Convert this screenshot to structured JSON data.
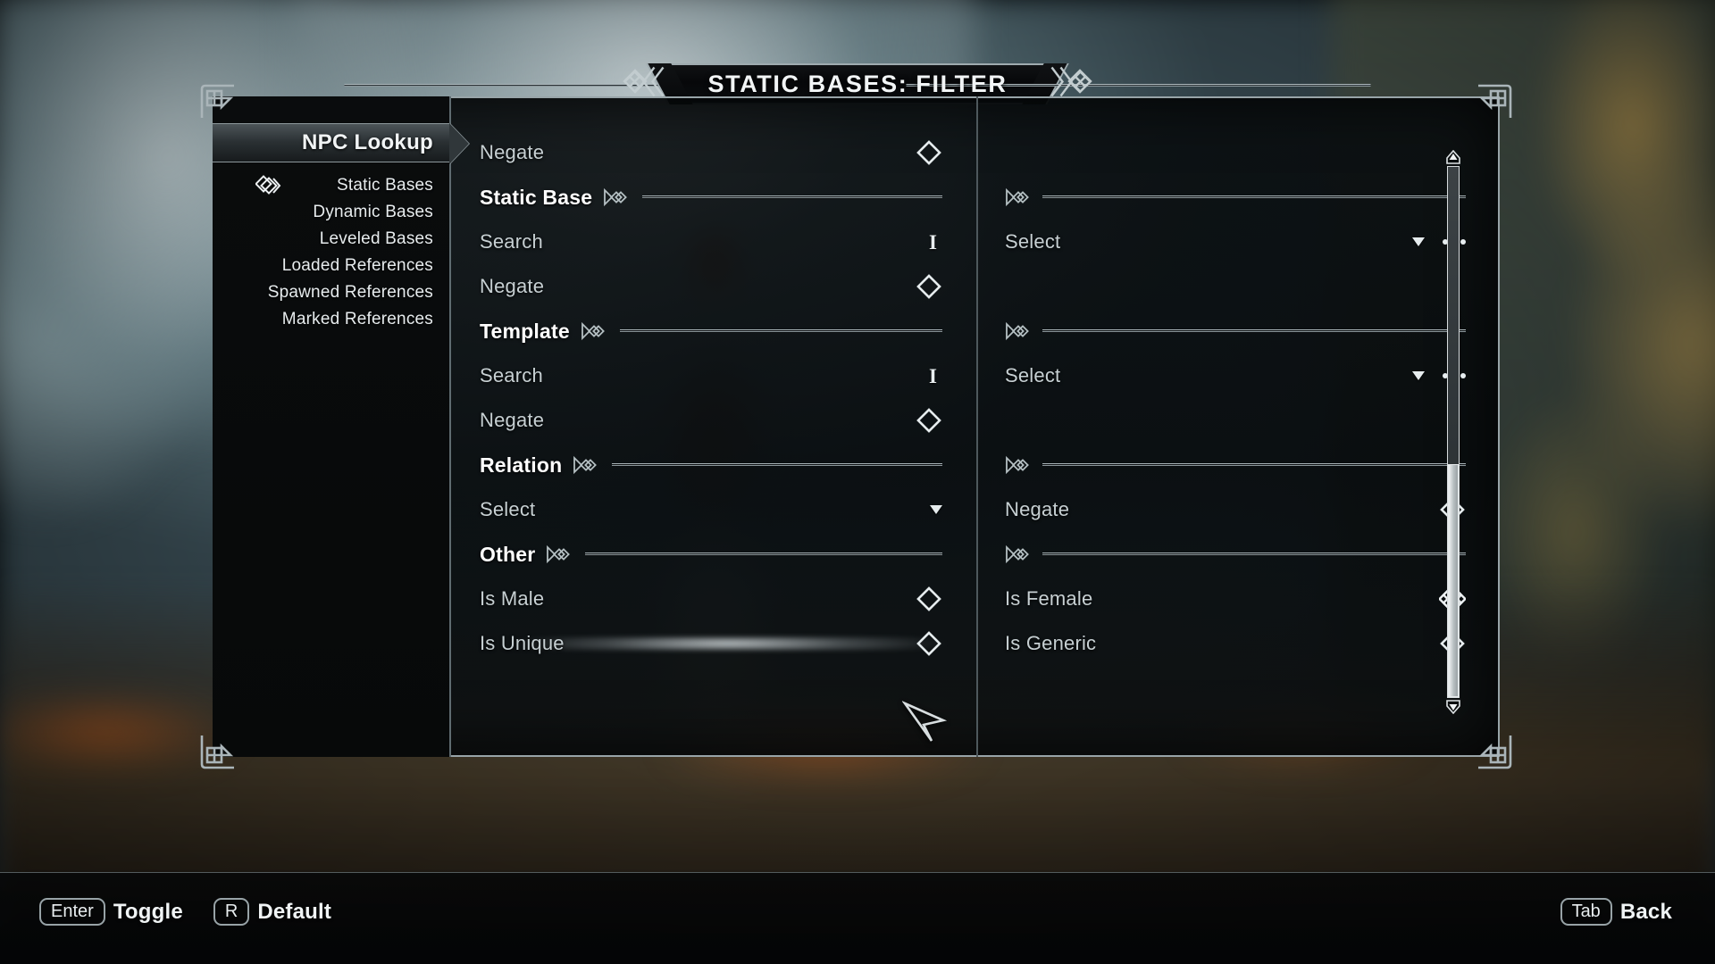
{
  "window": {
    "title": "STATIC BASES: FILTER"
  },
  "sidebar": {
    "header": "NPC Lookup",
    "items": [
      {
        "label": "Static Bases",
        "icon": "knot-marker-icon",
        "selected": true
      },
      {
        "label": "Dynamic Bases",
        "icon": "",
        "selected": false
      },
      {
        "label": "Leveled Bases",
        "icon": "",
        "selected": false
      },
      {
        "label": "Loaded References",
        "icon": "",
        "selected": false
      },
      {
        "label": "Spawned References",
        "icon": "",
        "selected": false
      },
      {
        "label": "Marked References",
        "icon": "",
        "selected": false
      }
    ]
  },
  "left_column": [
    {
      "type": "checkbox",
      "label": "Negate",
      "control": "diamond-unchecked-icon"
    },
    {
      "type": "section",
      "label": "Static Base",
      "control": "knot-divider-icon"
    },
    {
      "type": "text",
      "label": "Search",
      "control": "text-cursor-icon",
      "value": ""
    },
    {
      "type": "checkbox",
      "label": "Negate",
      "control": "diamond-unchecked-icon"
    },
    {
      "type": "section",
      "label": "Template",
      "control": "knot-divider-icon"
    },
    {
      "type": "text",
      "label": "Search",
      "control": "text-cursor-icon",
      "value": ""
    },
    {
      "type": "checkbox",
      "label": "Negate",
      "control": "diamond-unchecked-icon"
    },
    {
      "type": "section",
      "label": "Relation",
      "control": "knot-divider-icon"
    },
    {
      "type": "dropdown",
      "label": "Select",
      "control": "caret-down-icon"
    },
    {
      "type": "section",
      "label": "Other",
      "control": "knot-divider-icon"
    },
    {
      "type": "checkbox",
      "label": "Is Male",
      "control": "diamond-unchecked-icon"
    },
    {
      "type": "checkbox",
      "label": "Is Unique",
      "control": "diamond-unchecked-icon",
      "highlighted": true
    }
  ],
  "right_column": [
    {
      "type": "spacer",
      "label": "",
      "control": ""
    },
    {
      "type": "divider",
      "label": "",
      "control": "knot-divider-icon"
    },
    {
      "type": "dropdown",
      "label": "Select",
      "control": "caret-down-icon",
      "more": "ellipsis-icon"
    },
    {
      "type": "spacer",
      "label": "",
      "control": ""
    },
    {
      "type": "divider",
      "label": "",
      "control": "knot-divider-icon"
    },
    {
      "type": "dropdown",
      "label": "Select",
      "control": "caret-down-icon",
      "more": "ellipsis-icon"
    },
    {
      "type": "spacer",
      "label": "",
      "control": ""
    },
    {
      "type": "divider",
      "label": "",
      "control": "knot-divider-icon"
    },
    {
      "type": "checkbox",
      "label": "Negate",
      "control": "diamond-unchecked-icon"
    },
    {
      "type": "divider",
      "label": "",
      "control": "knot-divider-icon"
    },
    {
      "type": "checkbox",
      "label": "Is Female",
      "control": "diamond-checked-icon"
    },
    {
      "type": "checkbox",
      "label": "Is Generic",
      "control": "diamond-unchecked-icon"
    }
  ],
  "scrollbar": {
    "up_icon": "scroll-up-arrow-icon",
    "down_icon": "scroll-down-arrow-icon",
    "thumb_position_percent": 56
  },
  "hud": {
    "left": [
      {
        "key": "Enter",
        "label": "Toggle"
      },
      {
        "key": "R",
        "label": "Default"
      }
    ],
    "right": [
      {
        "key": "Tab",
        "label": "Back"
      }
    ]
  },
  "colors": {
    "frame_border": "#98a4a8",
    "text_primary": "#f1f4f5",
    "text_secondary": "#c7d0d3",
    "panel_bg": "#080b0d"
  }
}
